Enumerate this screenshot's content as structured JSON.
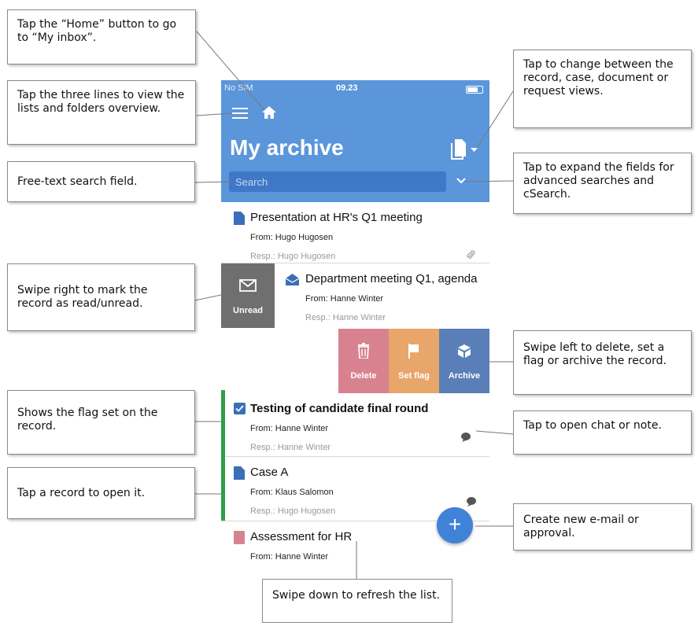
{
  "app": {
    "status_carrier": "No SIM",
    "status_time": "09.23",
    "title": "My archive",
    "search_placeholder": "Search"
  },
  "records": [
    {
      "title": "Presentation at HR's Q1 meeting",
      "from": "From: Hugo Hugosen",
      "resp": "Resp.: Hugo Hugosen"
    },
    {
      "title": "Department meeting Q1, agenda",
      "from": "From: Hanne Winter",
      "resp": "Resp.: Hanne Winter"
    },
    {
      "title": "Testing of candidate final round",
      "from": "From: Hanne Winter",
      "resp": "Resp.: Hanne Winter"
    },
    {
      "title": "Case A",
      "from": "From: Klaus Salomon",
      "resp": "Resp.: Hugo Hugosen"
    },
    {
      "title": "Assessment for HR",
      "from": "From: Hanne Winter"
    }
  ],
  "swipe_actions": {
    "unread": "Unread",
    "delete": "Delete",
    "set_flag": "Set flag",
    "archive": "Archive"
  },
  "colors": {
    "header": "#5b96db",
    "unread": "#6f6f6f",
    "delete": "#d9828f",
    "set_flag": "#e8a66a",
    "archive": "#5a7fb8",
    "flag": "#2e9e49",
    "fab": "#3f82d8"
  },
  "icons": {
    "menu": "hamburger-icon",
    "home": "home-icon",
    "view": "documents-icon",
    "expand": "chevron-down-icon",
    "attachment": "paperclip-icon",
    "chat": "chat-bubble-icon",
    "create": "plus-icon"
  },
  "callouts": {
    "home": "Tap the “Home” button to go to “My inbox”.",
    "menu": "Tap the three lines to view the lists and folders overview.",
    "search": "Free-text search field.",
    "unread": "Swipe right to mark the record as read/unread.",
    "flag": "Shows the flag set on the record.",
    "open": "Tap a record to open it.",
    "views": "Tap to change between the record, case, document or request views.",
    "expand": "Tap to expand the fields for advanced searches and cSearch.",
    "swipe_left": "Swipe left to delete, set a flag or archive the record.",
    "chat": "Tap to open chat or note.",
    "create": "Create new e-mail or approval.",
    "refresh": "Swipe down to refresh the list."
  }
}
